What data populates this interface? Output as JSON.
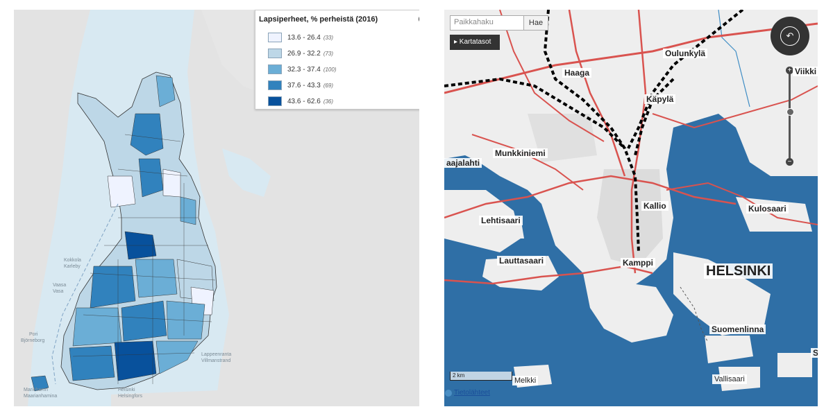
{
  "left_map": {
    "legend": {
      "title": "Lapsiperheet, % perheistä (2016)",
      "classes": [
        {
          "range": "13.6 - 26.4",
          "count": "(33)",
          "color": "#eff3ff"
        },
        {
          "range": "26.9 - 32.2",
          "count": "(73)",
          "color": "#bdd7e7"
        },
        {
          "range": "32.3 - 37.4",
          "count": "(100)",
          "color": "#6baed6"
        },
        {
          "range": "37.6 - 43.3",
          "count": "(69)",
          "color": "#3182bd"
        },
        {
          "range": "43.6 - 62.6",
          "count": "(36)",
          "color": "#08519c"
        }
      ]
    },
    "place_labels": {
      "kokkola": "Kokkola",
      "karleby": "Karleby",
      "vaasa": "Vaasa",
      "vasa": "Vasa",
      "pori": "Pori",
      "bjorneborg": "Björneborg",
      "lappeenranta": "Lappeenranta",
      "villmanstrand": "Villmanstrand",
      "helsinki": "Helsinki",
      "helsingfors": "Helsingfors",
      "maarianhamina": "Mariehamn",
      "mariehamn": "Maarianhamina"
    }
  },
  "right_map": {
    "search": {
      "placeholder": "Paikkahaku",
      "button": "Hae"
    },
    "layers_button": "▸ Kartatasot",
    "scale": "2 km",
    "credits": "Tietolähteet",
    "place_labels": {
      "oulunkyla": "Oulunkylä",
      "haaga": "Haaga",
      "kapyla": "Käpylä",
      "viikki": "Viikki",
      "munkkiniemi": "Munkkiniemi",
      "laajalahti": "aajalahti",
      "kallio": "Kallio",
      "lehtisaari": "Lehtisaari",
      "kulosaari": "Kulosaari",
      "lauttasaari": "Lauttasaari",
      "kamppi": "Kamppi",
      "helsinki": "HELSINKI",
      "suomenlinna": "Suomenlinna",
      "melkki": "Melkki",
      "vallisaari": "Vallisaari",
      "s_edge": "S"
    }
  }
}
